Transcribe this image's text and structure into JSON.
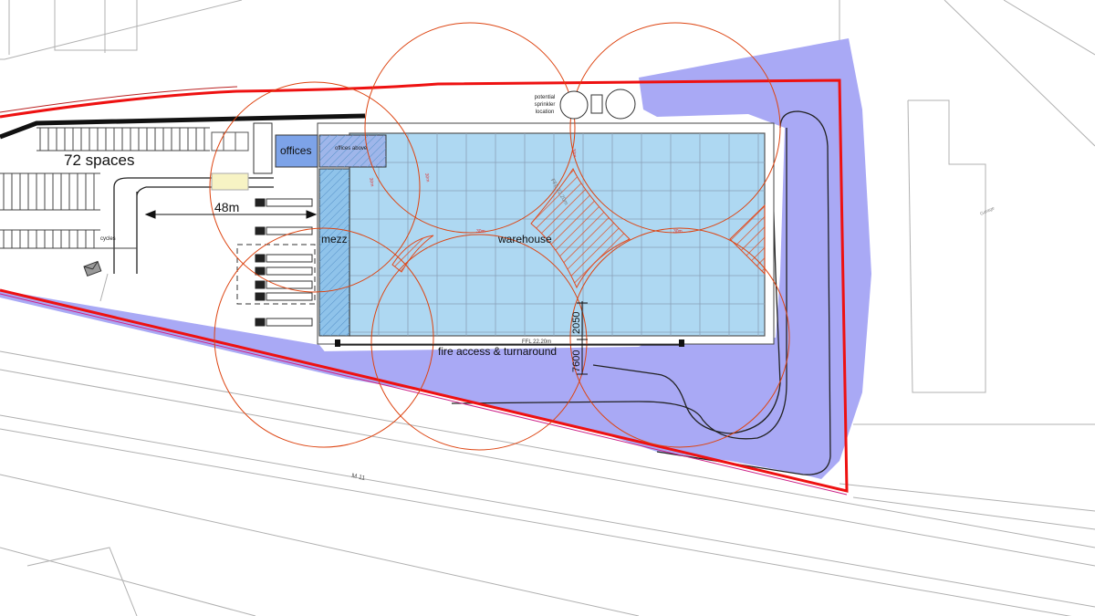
{
  "labels": {
    "parking": "72 spaces",
    "offices": "offices",
    "offices_above": "offices above",
    "mezz": "mezz",
    "warehouse": "warehouse",
    "distance": "48m",
    "cycles": "cycles",
    "fire_access": "fire access & turnaround",
    "ffl": "FFL 22.20m",
    "ffl_roof": "FFL 22.20m",
    "sprinkler": [
      "potential",
      "sprinkler",
      "location"
    ],
    "dim_2050": "2050",
    "dim_7600": "7600",
    "motorway": "M 11",
    "radius_1": "30m",
    "radius_2": "30m",
    "radius_3": "30m",
    "radius_4": "30m",
    "radius_5": "30m",
    "garage": "Garage"
  },
  "colors": {
    "site_boundary": "#ee1111",
    "hydrant_radius": "#dd4411",
    "flood_zone": "#a9a9f5",
    "warehouse_fill": "#aed8f2",
    "office_fill": "#7da3e8",
    "hatch": "#e34a1e"
  }
}
